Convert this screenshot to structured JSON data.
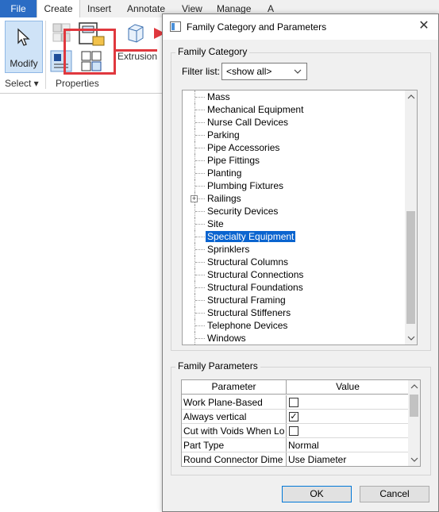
{
  "ribbon": {
    "tabs": [
      "File",
      "Create",
      "Insert",
      "Annotate",
      "View",
      "Manage",
      "A"
    ],
    "modify_label": "Modify",
    "select_label": "Select ▾",
    "properties_label": "Properties",
    "extrusion_label": "Extrusion"
  },
  "dialog": {
    "title": "Family Category and Parameters",
    "close_glyph": "✕",
    "category_group": "Family Category",
    "filter_label": "Filter list:",
    "filter_value": "<show all>",
    "categories": [
      "Mass",
      "Mechanical Equipment",
      "Nurse Call Devices",
      "Parking",
      "Pipe Accessories",
      "Pipe Fittings",
      "Planting",
      "Plumbing Fixtures",
      "Railings",
      "Security Devices",
      "Site",
      "Specialty Equipment",
      "Sprinklers",
      "Structural Columns",
      "Structural Connections",
      "Structural Foundations",
      "Structural Framing",
      "Structural Stiffeners",
      "Telephone Devices",
      "Windows"
    ],
    "selected_category": "Specialty Equipment",
    "expandable_category": "Railings",
    "parameters_group": "Family Parameters",
    "param_header": "Parameter",
    "value_header": "Value",
    "parameters": [
      {
        "name": "Work Plane-Based",
        "value": "",
        "checked": false
      },
      {
        "name": "Always vertical",
        "value": "",
        "checked": true
      },
      {
        "name": "Cut with Voids When Lo",
        "value": "",
        "checked": false
      },
      {
        "name": "Part Type",
        "value": "Normal"
      },
      {
        "name": "Round Connector Dime",
        "value": "Use Diameter"
      }
    ],
    "ok_label": "OK",
    "cancel_label": "Cancel"
  },
  "colors": {
    "accent": "#0a64cf",
    "file_tab": "#2b6cc4",
    "highlight": "#e0383e"
  }
}
